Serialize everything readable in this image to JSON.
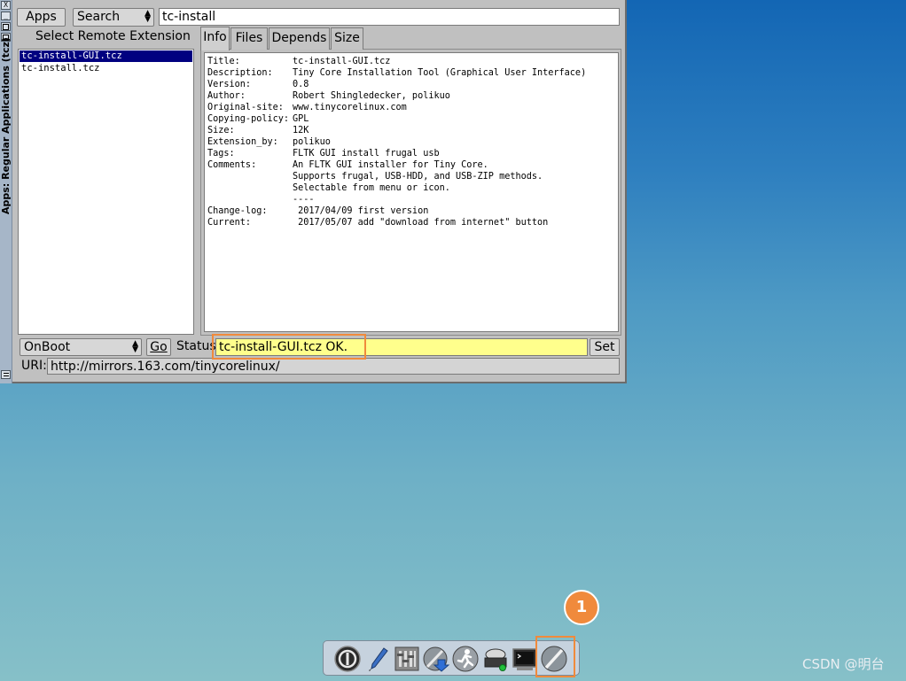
{
  "window": {
    "vertical_title": "Apps: Regular Applications (tcz)",
    "titlebar_buttons": [
      "X",
      "_",
      "O",
      "O"
    ]
  },
  "toolbar": {
    "apps_label": "Apps",
    "search_mode": "Search",
    "search_value": "tc-install"
  },
  "left_panel": {
    "heading": "Select Remote Extension",
    "items": [
      {
        "label": "tc-install-GUI.tcz",
        "selected": true
      },
      {
        "label": "tc-install.tcz",
        "selected": false
      }
    ]
  },
  "tabs": [
    {
      "label": "Info",
      "active": true
    },
    {
      "label": "Files",
      "active": false
    },
    {
      "label": "Depends",
      "active": false
    },
    {
      "label": "Size",
      "active": false
    }
  ],
  "info": {
    "rows": [
      {
        "k": "Title:",
        "v": "tc-install-GUI.tcz"
      },
      {
        "k": "Description:",
        "v": "Tiny Core Installation Tool (Graphical User Interface)"
      },
      {
        "k": "Version:",
        "v": "0.8"
      },
      {
        "k": "Author:",
        "v": "Robert Shingledecker, polikuo"
      },
      {
        "k": "Original-site:",
        "v": "www.tinycorelinux.com"
      },
      {
        "k": "Copying-policy:",
        "v": "GPL"
      },
      {
        "k": "Size:",
        "v": "12K"
      },
      {
        "k": "Extension_by:",
        "v": "polikuo"
      },
      {
        "k": "Tags:",
        "v": "FLTK GUI install frugal usb"
      },
      {
        "k": "Comments:",
        "v": "An FLTK GUI installer for Tiny Core."
      },
      {
        "k": "",
        "v": "Supports frugal, USB-HDD, and USB-ZIP methods."
      },
      {
        "k": "",
        "v": "Selectable from menu or icon."
      },
      {
        "k": "",
        "v": "----"
      },
      {
        "k": "Change-log:",
        "v": " 2017/04/09 first version"
      },
      {
        "k": "Current:",
        "v": " 2017/05/07 add \"download from internet\" button"
      }
    ]
  },
  "bottom": {
    "install_mode": "OnBoot",
    "go_label": "Go",
    "status_label": "Status",
    "status_value": "tc-install-GUI.tcz OK.",
    "set_label": "Set",
    "uri_label": "URI:",
    "uri_value": "http://mirrors.163.com/tinycorelinux/"
  },
  "annotation": {
    "badge_number": "1",
    "highlight_color": "#f08a3c"
  },
  "dock": {
    "icons": [
      "exit-icon",
      "editor-pen-icon",
      "control-panel-icon",
      "apps-download-icon",
      "run-icon",
      "mount-tool-icon",
      "terminal-icon",
      "tc-install-icon"
    ]
  },
  "watermark": "CSDN @明台"
}
